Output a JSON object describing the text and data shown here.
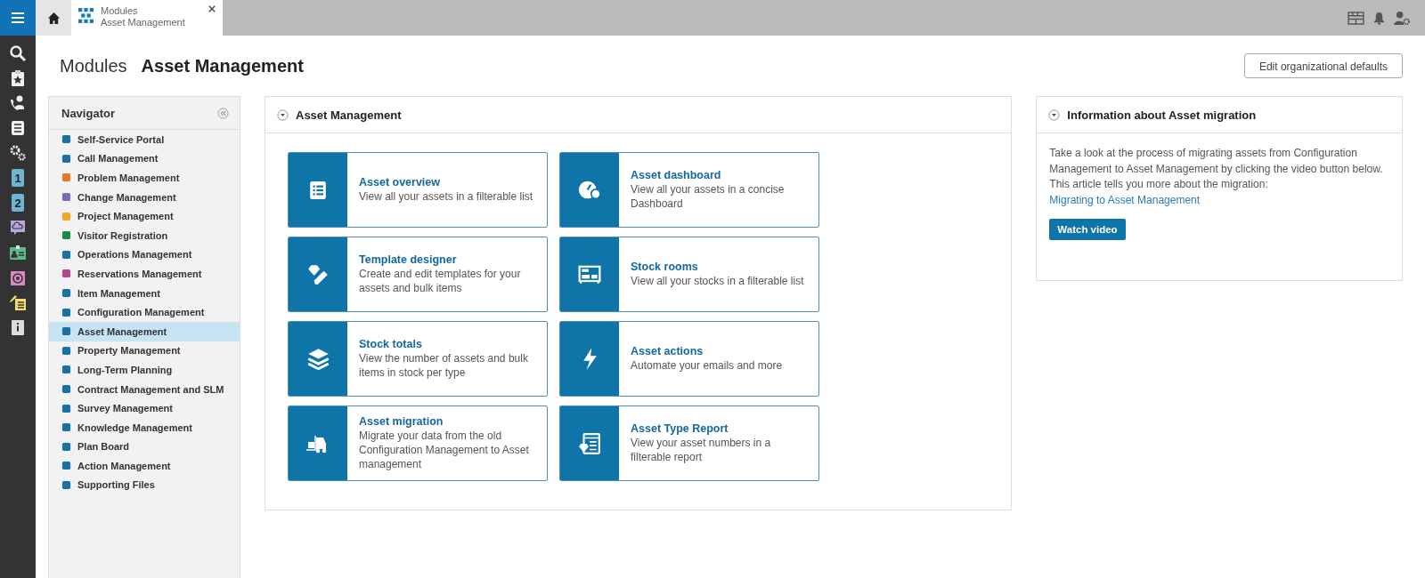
{
  "rail": [
    {
      "kind": "search"
    },
    {
      "kind": "clipboard"
    },
    {
      "kind": "phone"
    },
    {
      "kind": "list"
    },
    {
      "kind": "gears"
    },
    {
      "kind": "number",
      "label": "1",
      "color": "#6fb3d2"
    },
    {
      "kind": "number",
      "label": "2",
      "color": "#6fb3d2"
    },
    {
      "kind": "cloud",
      "color": "#b9a6dd"
    },
    {
      "kind": "card",
      "color": "#5dbb8a"
    },
    {
      "kind": "calendar",
      "color": "#d98bbf"
    },
    {
      "kind": "rocket",
      "color": "#f2dc6b"
    },
    {
      "kind": "info",
      "color": "#dddddd"
    }
  ],
  "tab": {
    "line1": "Modules",
    "line2": "Asset Management"
  },
  "page": {
    "crumb": "Modules",
    "title": "Asset Management",
    "button": "Edit organizational defaults"
  },
  "navigator": {
    "title": "Navigator",
    "items": [
      {
        "label": "Self-Service Portal",
        "color": "#1a6fa3",
        "selected": false
      },
      {
        "label": "Call Management",
        "color": "#1a6fa3",
        "selected": false
      },
      {
        "label": "Problem Management",
        "color": "#e8762c",
        "selected": false
      },
      {
        "label": "Change Management",
        "color": "#7b6bb5",
        "selected": false
      },
      {
        "label": "Project Management",
        "color": "#f0a822",
        "selected": false
      },
      {
        "label": "Visitor Registration",
        "color": "#1b8a4a",
        "selected": false
      },
      {
        "label": "Operations Management",
        "color": "#1a6fa3",
        "selected": false
      },
      {
        "label": "Reservations Management",
        "color": "#b04a8c",
        "selected": false
      },
      {
        "label": "Item Management",
        "color": "#1a6fa3",
        "selected": false
      },
      {
        "label": "Configuration Management",
        "color": "#1a6fa3",
        "selected": false
      },
      {
        "label": "Asset Management",
        "color": "#1a6fa3",
        "selected": true
      },
      {
        "label": "Property Management",
        "color": "#1a6fa3",
        "selected": false
      },
      {
        "label": "Long-Term Planning",
        "color": "#1a6fa3",
        "selected": false
      },
      {
        "label": "Contract Management and SLM",
        "color": "#1a6fa3",
        "selected": false
      },
      {
        "label": "Survey Management",
        "color": "#1a6fa3",
        "selected": false
      },
      {
        "label": "Knowledge Management",
        "color": "#1a6fa3",
        "selected": false
      },
      {
        "label": "Plan Board",
        "color": "#1a6fa3",
        "selected": false
      },
      {
        "label": "Action Management",
        "color": "#1a6fa3",
        "selected": false
      },
      {
        "label": "Supporting Files",
        "color": "#1a6fa3",
        "selected": false
      }
    ]
  },
  "modules": {
    "title": "Asset Management",
    "cards": [
      {
        "kind": "list",
        "title": "Asset overview",
        "text": "View all your assets in a filterable list"
      },
      {
        "kind": "dashboard",
        "title": "Asset dashboard",
        "text": "View all your assets in a concise Dashboard"
      },
      {
        "kind": "designer",
        "title": "Template designer",
        "text": "Create and edit templates for your assets and bulk items"
      },
      {
        "kind": "stockroom",
        "title": "Stock rooms",
        "text": "View all your stocks in a filterable list"
      },
      {
        "kind": "layers",
        "title": "Stock totals",
        "text": "View the number of assets and bulk items in stock per type"
      },
      {
        "kind": "bolt",
        "title": "Asset actions",
        "text": "Automate your emails and more"
      },
      {
        "kind": "forklift",
        "title": "Asset migration",
        "text": "Migrate your data from the old Configuration Management to Asset management"
      },
      {
        "kind": "report",
        "title": "Asset Type Report",
        "text": "View your asset numbers in a filterable report"
      }
    ]
  },
  "info": {
    "title": "Information about Asset migration",
    "text": "Take a look at the process of migrating assets from Configuration Management to Asset Management by clicking the video button below. This article tells you more about the migration:",
    "link": "Migrating to Asset Management",
    "button": "Watch video"
  }
}
